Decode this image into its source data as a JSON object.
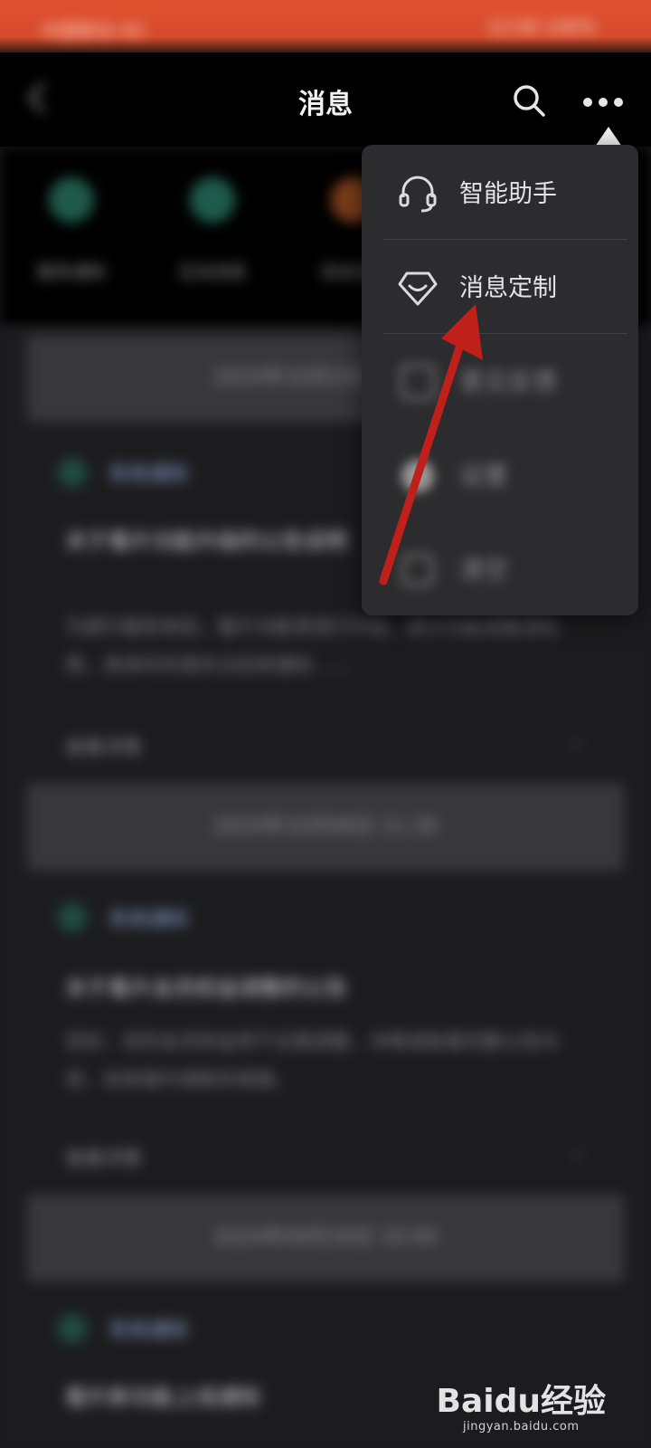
{
  "status_bar": {
    "left_text": "中国移动 4G",
    "right_text": "12:00 100%",
    "color": "#d94e2e"
  },
  "nav": {
    "title": "消息",
    "icons": [
      "back-icon",
      "search-icon",
      "more-icon"
    ]
  },
  "quick_row": {
    "items": [
      {
        "label": "服务通知",
        "color": "#1f5a49"
      },
      {
        "label": "互动消息",
        "color": "#1e5b4c"
      },
      {
        "label": "活动消息",
        "color": "#7a3d1a"
      }
    ]
  },
  "menu": {
    "items": [
      {
        "label": "智能助手",
        "icon": "headset-icon"
      },
      {
        "label": "消息定制",
        "icon": "diamond-chat-icon"
      },
      {
        "label": "意见反馈",
        "icon": "feedback-icon"
      },
      {
        "label": "设置",
        "icon": "settings-icon"
      },
      {
        "label": "清空",
        "icon": "clear-icon"
      }
    ]
  },
  "feed": {
    "banners": [
      "2024年10月15日 12:00",
      "2024年10月08日 11:30",
      "2024年09月30日 10:00"
    ],
    "cards": [
      {
        "sender": "系统通知",
        "title": "关于看片功能升级的公告说明",
        "body": "为提升服务体验，看片功能将进行升级，部分功能调整请知悉，具体时间请关注后续通知……",
        "footer": "查看详情"
      },
      {
        "sender": "系统通知",
        "title": "关于看片会员权益调整的公告",
        "body": "您好，您的会员权益将于近期调整，详情请查看完整公告内容，如有疑问请联系客服。",
        "footer": "查看详情"
      },
      {
        "sender": "系统通知",
        "title": "看片新功能上线通知",
        "body": "",
        "footer": ""
      }
    ]
  },
  "watermark": {
    "logo": "Baidu经验",
    "url": "jingyan.baidu.com"
  },
  "colors": {
    "background": "#1c1c1e",
    "menu_bg": "#2c2c2e",
    "annotation_arrow": "#c0201a"
  }
}
